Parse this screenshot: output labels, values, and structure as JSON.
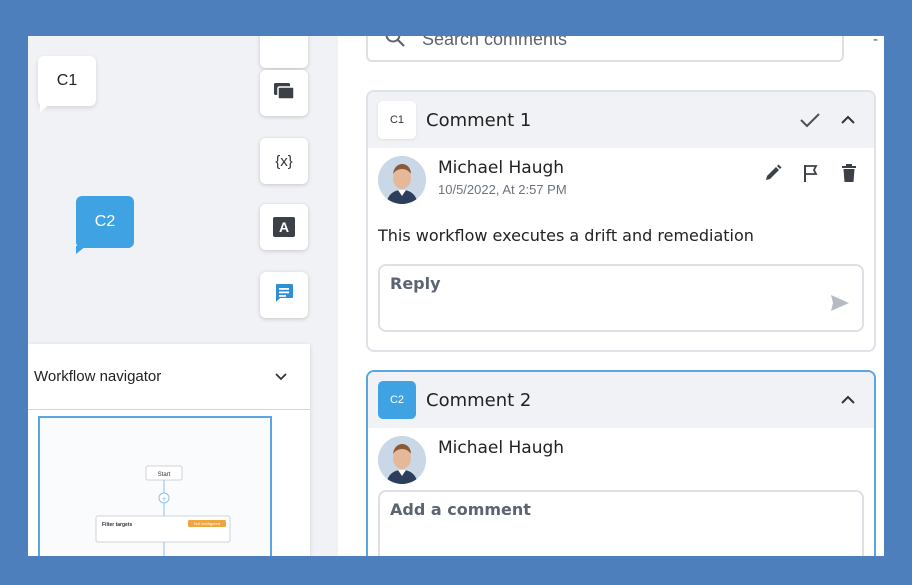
{
  "canvas": {
    "bubble_c1": "C1",
    "bubble_c2": "C2",
    "toolbar": {
      "tools": [
        "layers-icon",
        "variable-icon",
        "text-icon",
        "comment-icon"
      ],
      "variable_label": "{x}",
      "text_label": "A"
    },
    "navigator": {
      "title": "Workflow navigator",
      "minimap": {
        "start_label": "Start",
        "node_label": "Filter targets",
        "node_badge": "Not configured"
      }
    }
  },
  "panel": {
    "search": {
      "placeholder": "Search comments"
    },
    "dash": "-",
    "comments": [
      {
        "badge": "C1",
        "title": "Comment 1",
        "author": "Michael Haugh",
        "date": "10/5/2022, At 2:57 PM",
        "text": "This workflow executes a drift and remediation",
        "reply_placeholder": "Reply"
      },
      {
        "badge": "C2",
        "title": "Comment 2",
        "author": "Michael Haugh",
        "input_placeholder": "Add a comment"
      }
    ]
  },
  "colors": {
    "accent": "#3fa3e3",
    "frame": "#4d7fbd",
    "icon": "#3c4148"
  }
}
